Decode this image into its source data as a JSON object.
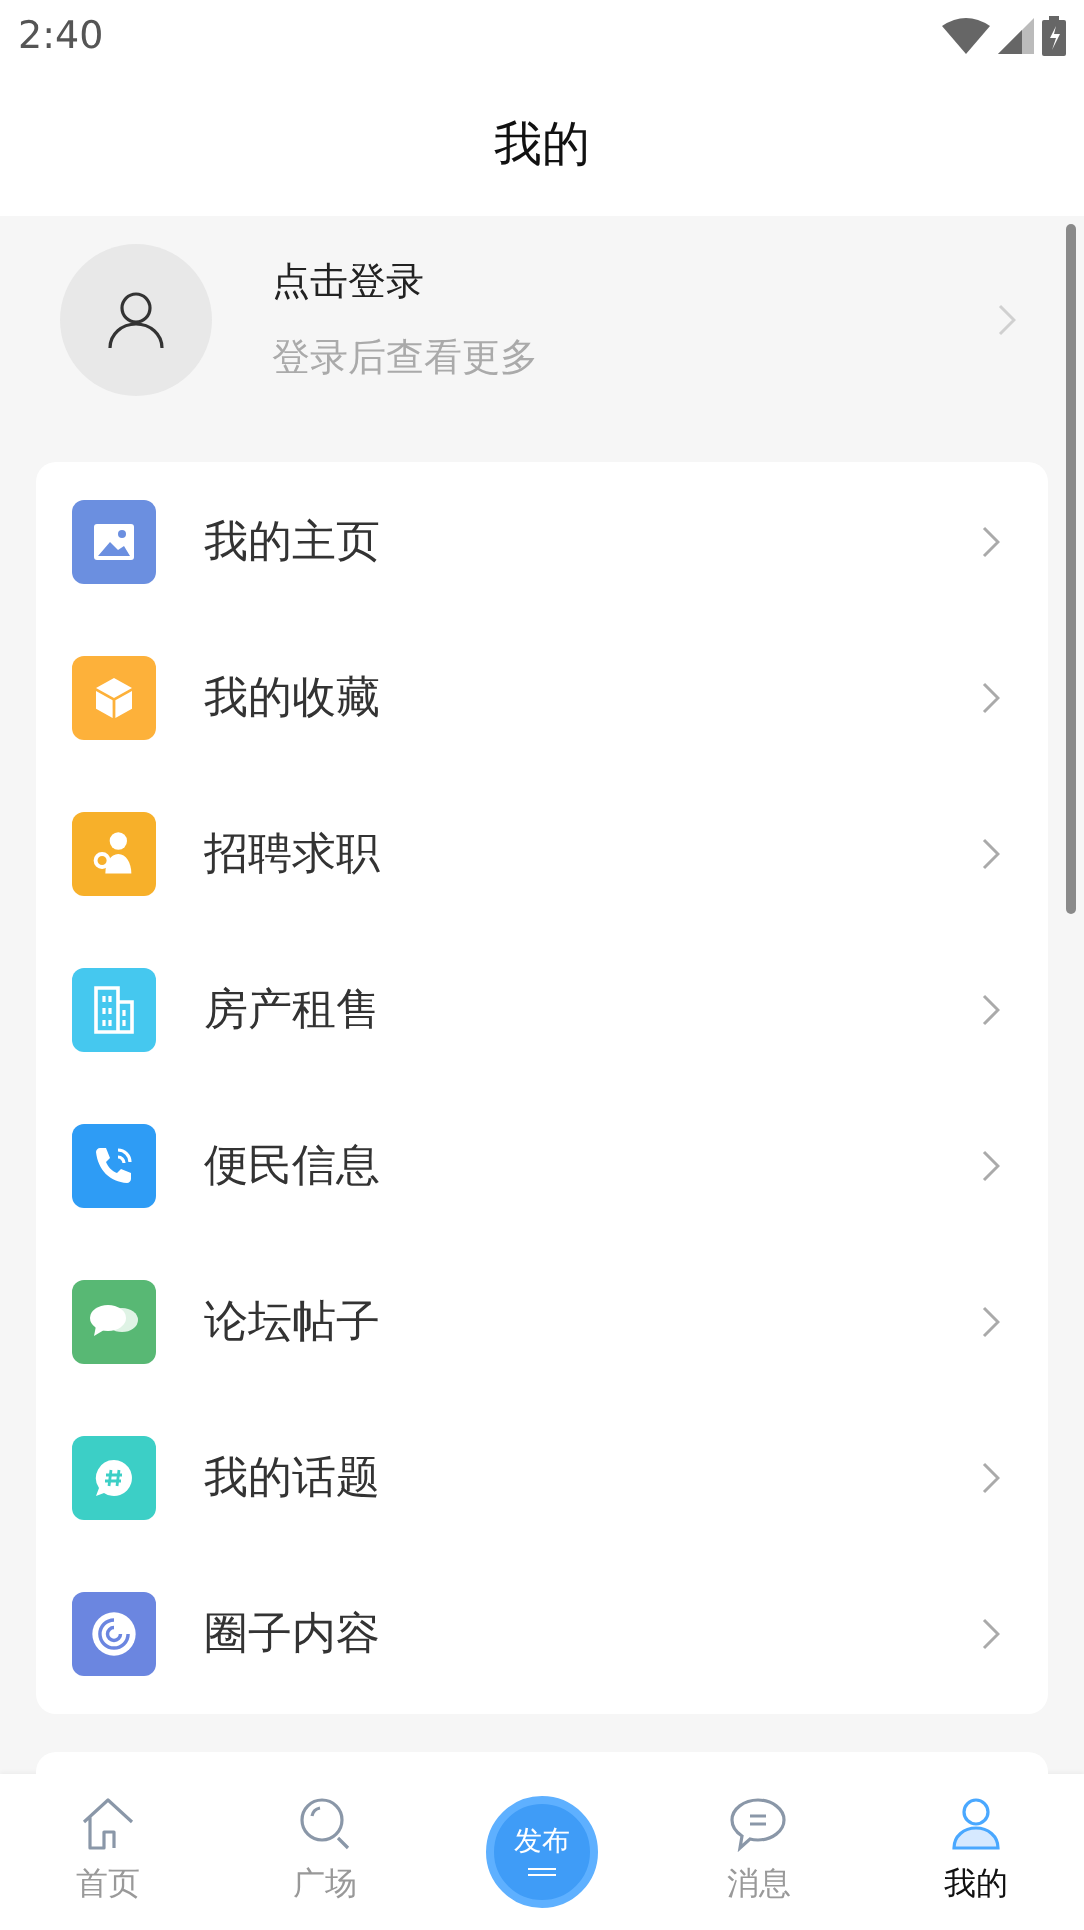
{
  "status_bar": {
    "time": "2:40"
  },
  "header": {
    "title": "我的"
  },
  "profile": {
    "title": "点击登录",
    "subtitle": "登录后查看更多"
  },
  "menu": [
    {
      "label": "我的主页",
      "kind": "image",
      "color": "#6b8fe0"
    },
    {
      "label": "我的收藏",
      "kind": "box",
      "color": "#fdb13a"
    },
    {
      "label": "招聘求职",
      "kind": "job",
      "color": "#f7b02a"
    },
    {
      "label": "房产租售",
      "kind": "building",
      "color": "#45c8ef"
    },
    {
      "label": "便民信息",
      "kind": "phone",
      "color": "#2e9cf5"
    },
    {
      "label": "论坛帖子",
      "kind": "chat",
      "color": "#58b874"
    },
    {
      "label": "我的话题",
      "kind": "topic",
      "color": "#3ccfc6"
    },
    {
      "label": "圈子内容",
      "kind": "circle",
      "color": "#6b86e0"
    }
  ],
  "tab_bar": [
    {
      "label": "首页",
      "kind": "home",
      "selected": false
    },
    {
      "label": "广场",
      "kind": "search",
      "selected": false
    },
    {
      "label": "发布",
      "kind": "publish",
      "selected": false
    },
    {
      "label": "消息",
      "kind": "message",
      "selected": false
    },
    {
      "label": "我的",
      "kind": "profile",
      "selected": true
    }
  ]
}
